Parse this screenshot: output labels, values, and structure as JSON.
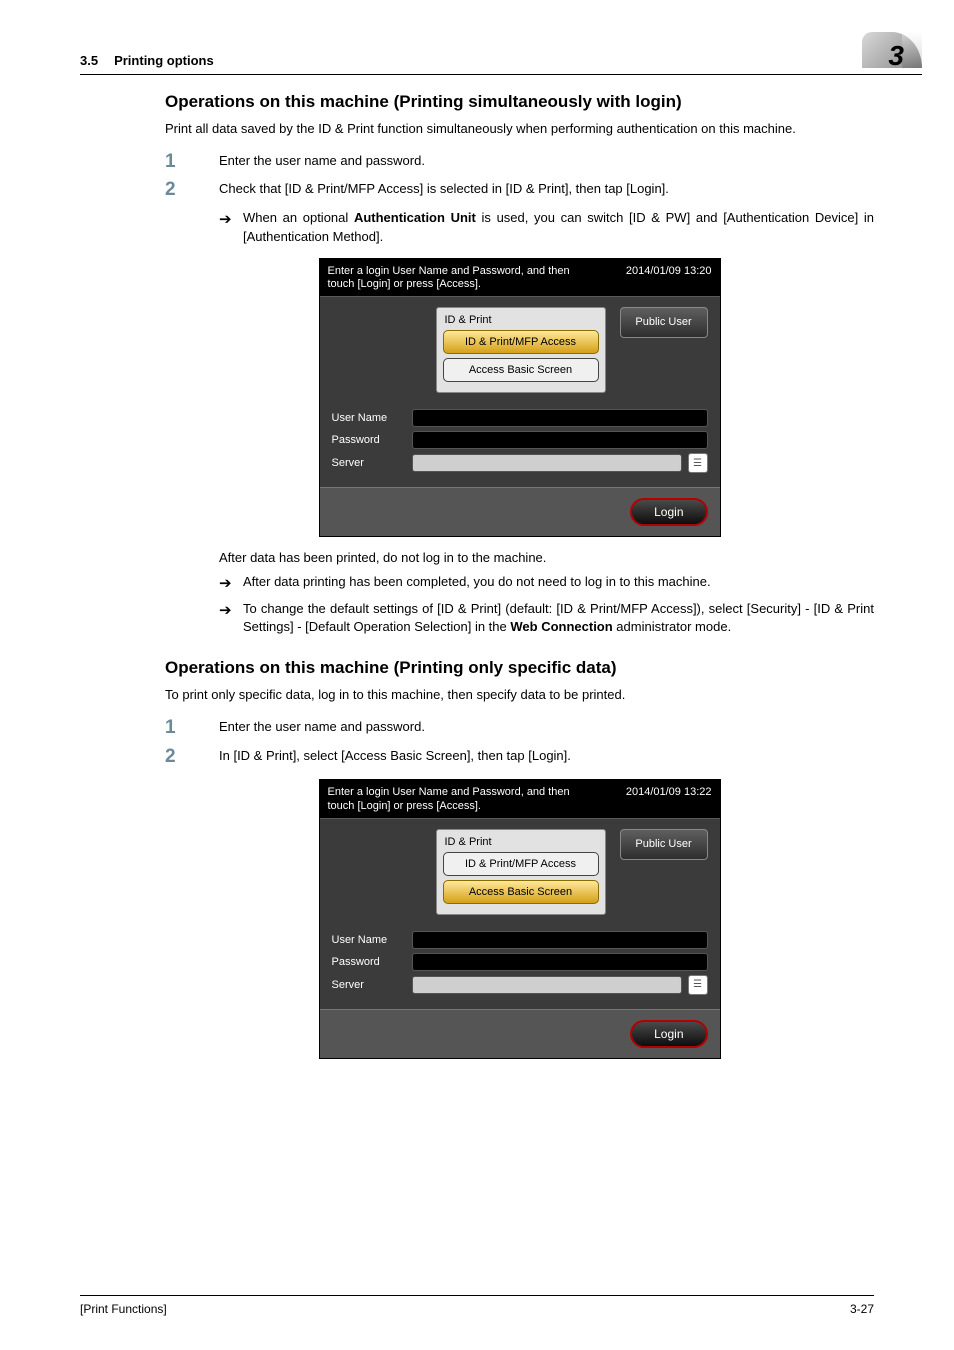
{
  "header": {
    "section_num": "3.5",
    "section_title": "Printing options",
    "chapter_num": "3"
  },
  "section1": {
    "heading": "Operations on this machine (Printing simultaneously with login)",
    "intro": "Print all data saved by the ID & Print function simultaneously when performing authentication on this machine.",
    "step1_num": "1",
    "step1_body": "Enter the user name and password.",
    "step2_num": "2",
    "step2_body": "Check that [ID & Print/MFP Access] is selected in [ID & Print], then tap [Login].",
    "step2_sub_pre": "When an optional ",
    "step2_sub_bold": "Authentication Unit",
    "step2_sub_post": " is used, you can switch [ID & PW] and [Authentication Device] in [Authentication Method].",
    "after_para": "After data has been printed, do not log in to the machine.",
    "after_sub1": "After data printing has been completed, you do not need to log in to this machine.",
    "after_sub2_pre": "To change the default settings of [ID & Print] (default: [ID & Print/MFP Access]), select [Security] - [ID & Print Settings] - [Default Operation Selection] in the ",
    "after_sub2_bold": "Web Connection",
    "after_sub2_post": " administrator mode."
  },
  "section2": {
    "heading": "Operations on this machine (Printing only specific data)",
    "intro": "To print only specific data, log in to this machine, then specify data to be printed.",
    "step1_num": "1",
    "step1_body": "Enter the user name and password.",
    "step2_num": "2",
    "step2_body": "In [ID & Print], select [Access Basic Screen], then tap [Login]."
  },
  "panel1": {
    "prompt": "Enter a login User Name and Password, and then touch [Login] or press [Access].",
    "timestamp": "2014/01/09 13:20",
    "group_title": "ID & Print",
    "opt1": "ID & Print/MFP Access",
    "opt2": "Access Basic Screen",
    "public_user": "Public User",
    "lbl_user": "User Name",
    "lbl_pass": "Password",
    "lbl_server": "Server",
    "login": "Login"
  },
  "panel2": {
    "prompt": "Enter a login User Name and Password, and then touch [Login] or press [Access].",
    "timestamp": "2014/01/09 13:22",
    "group_title": "ID & Print",
    "opt1": "ID & Print/MFP Access",
    "opt2": "Access Basic Screen",
    "public_user": "Public User",
    "lbl_user": "User Name",
    "lbl_pass": "Password",
    "lbl_server": "Server",
    "login": "Login"
  },
  "footer": {
    "doc_title": "[Print Functions]",
    "page_num": "3-27"
  }
}
